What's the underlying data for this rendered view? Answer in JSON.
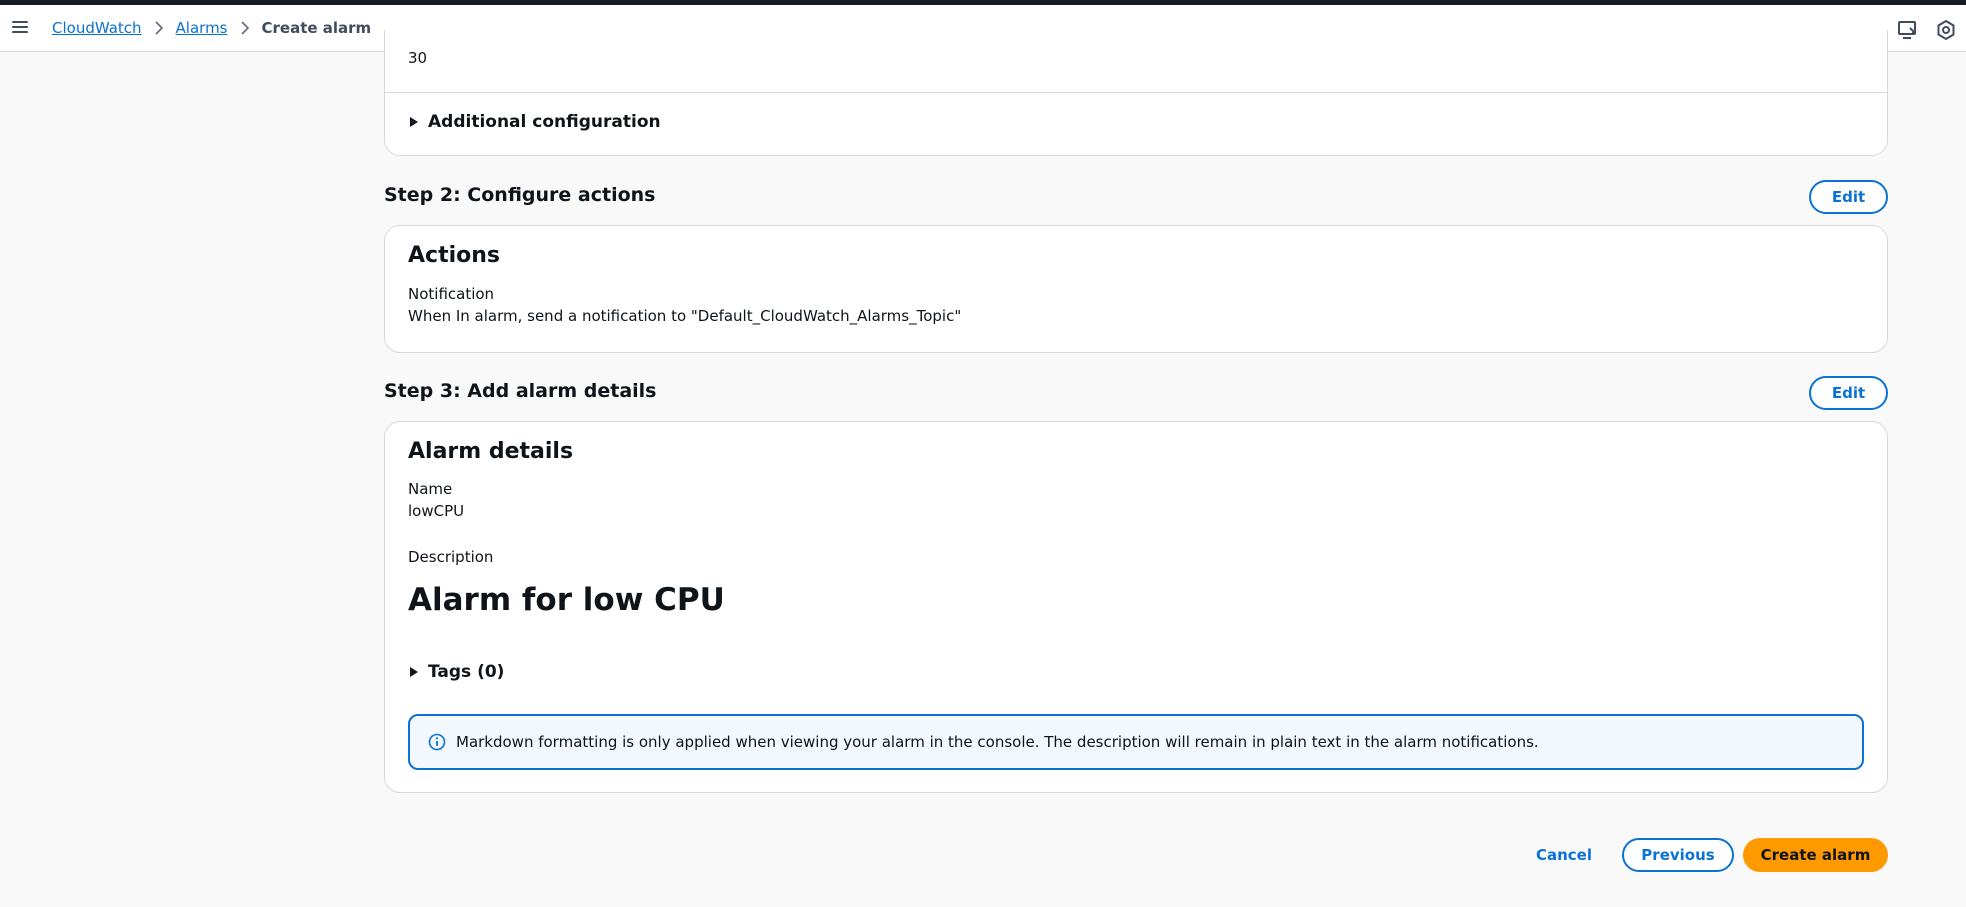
{
  "header": {
    "breadcrumb": {
      "items": [
        "CloudWatch",
        "Alarms"
      ],
      "current": "Create alarm"
    },
    "icons": [
      "menu-icon",
      "cloudshell-icon",
      "settings-icon"
    ]
  },
  "step1": {
    "value": "30",
    "additional_configuration": "Additional configuration"
  },
  "step2": {
    "title": "Step 2: Configure actions",
    "edit_label": "Edit",
    "card_heading": "Actions",
    "notification_label": "Notification",
    "notification_value": "When In alarm, send a notification to \"Default_CloudWatch_Alarms_Topic\""
  },
  "step3": {
    "title": "Step 3: Add alarm details",
    "edit_label": "Edit",
    "card_heading": "Alarm details",
    "name_label": "Name",
    "name_value": "lowCPU",
    "description_label": "Description",
    "description_value": "Alarm for low CPU",
    "tags_label": "Tags (0)",
    "info_text": "Markdown formatting is only applied when viewing your alarm in the console. The description will remain in plain text in the alarm notifications."
  },
  "footer": {
    "cancel_label": "Cancel",
    "previous_label": "Previous",
    "create_label": "Create alarm"
  },
  "colors": {
    "link": "#0972d3",
    "primary_button": "#ff9900",
    "info_background": "#f2f8fd"
  }
}
